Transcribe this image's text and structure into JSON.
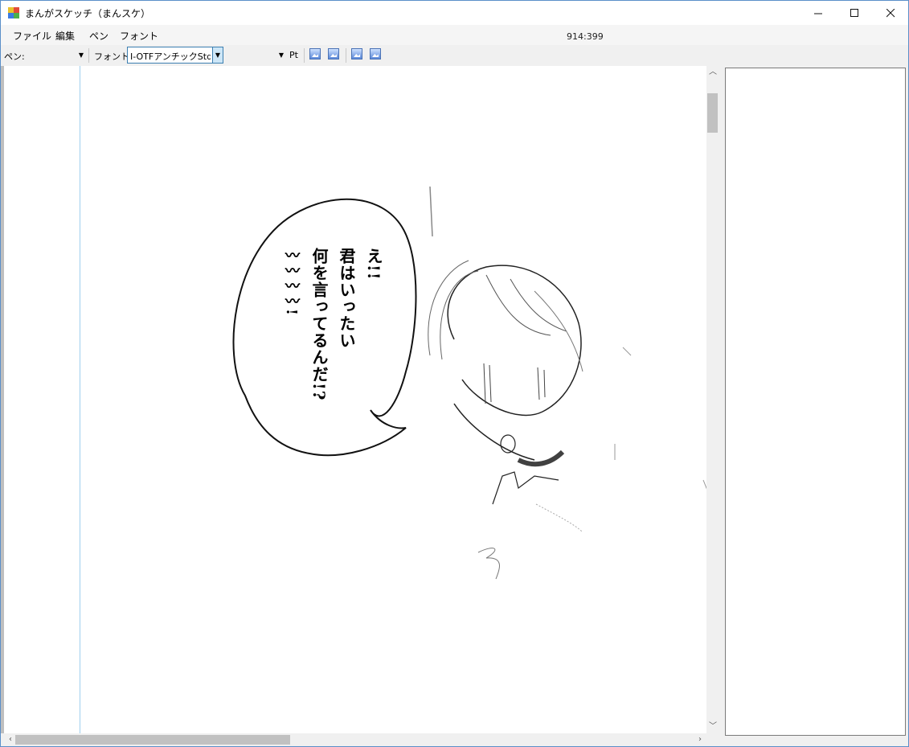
{
  "window": {
    "title": "まんがスケッチ（まんスケ）",
    "min_icon": "minimize-icon",
    "max_icon": "maximize-icon",
    "close_icon": "close-icon"
  },
  "menu": {
    "items": [
      "ファイル",
      "編集",
      "ペン",
      "フォント"
    ],
    "coordinates": "914:399"
  },
  "toolbar": {
    "pen_label": "ペン:",
    "pen_value": "",
    "font_label": "フォント:",
    "font_value": "I-OTFアンチックStd B",
    "size_value": "",
    "pt_label": "Pt",
    "image_buttons": [
      "image-icon",
      "image-icon",
      "image-icon",
      "image-icon"
    ]
  },
  "canvas": {
    "speech_columns": [
      "え!!",
      "君はいったい",
      "何を言ってるんだ!?",
      "〰〰〰〰!"
    ]
  },
  "colors": {
    "accent": "#3c7fb1",
    "guide": "#9fd0ef",
    "window_border": "#5b8fc9"
  }
}
